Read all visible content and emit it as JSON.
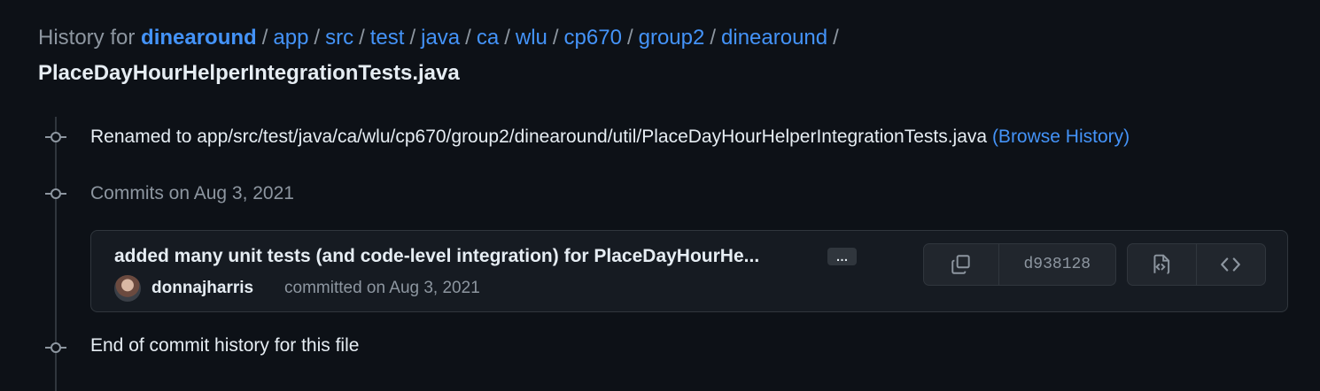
{
  "header": {
    "prefix": "History for",
    "repo": "dinearound",
    "path": [
      "app",
      "src",
      "test",
      "java",
      "ca",
      "wlu",
      "cp670",
      "group2",
      "dinearound"
    ],
    "filename": "PlaceDayHourHelperIntegrationTests.java"
  },
  "rename": {
    "text": "Renamed to app/src/test/java/ca/wlu/cp670/group2/dinearound/util/PlaceDayHourHelperIntegrationTests.java",
    "browse_link": "(Browse History)"
  },
  "commit_group": {
    "label": "Commits on Aug 3, 2021"
  },
  "commit": {
    "message": "added many unit tests (and code-level integration) for PlaceDayHourHe...",
    "more_label": "…",
    "author": "donnajharris",
    "committed_text": "committed on Aug 3, 2021",
    "sha": "d938128"
  },
  "footer": {
    "text": "End of commit history for this file"
  },
  "icons": {
    "copy": "copy-icon",
    "browse_file": "file-code-icon",
    "browse_repo": "code-icon",
    "timeline": "commit-node-icon"
  },
  "colors": {
    "background": "#0d1117",
    "link": "#4493f8",
    "muted": "#8d96a0",
    "card": "#161b22",
    "border": "#30363d"
  }
}
